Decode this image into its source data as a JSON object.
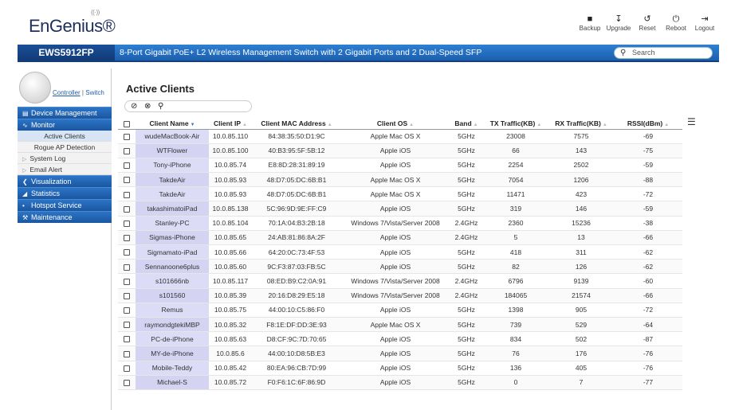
{
  "header": {
    "logo": "EnGenius®",
    "model": "EWS5912FP",
    "description": "8-Port Gigabit PoE+ L2 Wireless Management Switch with 2 Gigabit Ports and 2 Dual-Speed SFP",
    "search_placeholder": "Search",
    "tools": [
      {
        "label": "Backup",
        "icon": "save-icon"
      },
      {
        "label": "Upgrade",
        "icon": "upgrade-icon"
      },
      {
        "label": "Reset",
        "icon": "reset-icon"
      },
      {
        "label": "Reboot",
        "icon": "power-icon"
      },
      {
        "label": "Logout",
        "icon": "logout-icon"
      }
    ]
  },
  "sidebar": {
    "controller": "Controller",
    "separator": "|",
    "switch": "Switch",
    "menu": {
      "device_management": "Device Management",
      "monitor": "Monitor",
      "active_clients": "Active Clients",
      "rogue_ap": "Rogue AP Detection",
      "system_log": "System Log",
      "email_alert": "Email Alert",
      "visualization": "Visualization",
      "statistics": "Statistics",
      "hotspot": "Hotspot Service",
      "maintenance": "Maintenance"
    }
  },
  "main": {
    "title": "Active Clients",
    "columns": [
      "Client Name",
      "Client IP",
      "Client MAC Address",
      "Client OS",
      "Band",
      "TX Traffic(KB)",
      "RX Traffic(KB)",
      "RSSI(dBm)"
    ],
    "rows": [
      [
        "wudeMacBook-Air",
        "10.0.85.110",
        "84:38:35:50:D1:9C",
        "Apple Mac OS X",
        "5GHz",
        "23008",
        "7575",
        "-69"
      ],
      [
        "WTFlower",
        "10.0.85.100",
        "40:B3:95:5F:5B:12",
        "Apple iOS",
        "5GHz",
        "66",
        "143",
        "-75"
      ],
      [
        "Tony-iPhone",
        "10.0.85.74",
        "E8:8D:28:31:89:19",
        "Apple iOS",
        "5GHz",
        "2254",
        "2502",
        "-59"
      ],
      [
        "TakdeAir",
        "10.0.85.93",
        "48:D7:05:DC:6B:B1",
        "Apple Mac OS X",
        "5GHz",
        "7054",
        "1206",
        "-88"
      ],
      [
        "TakdeAir",
        "10.0.85.93",
        "48:D7:05:DC:6B:B1",
        "Apple Mac OS X",
        "5GHz",
        "11471",
        "423",
        "-72"
      ],
      [
        "takashimatoiPad",
        "10.0.85.138",
        "5C:96:9D:9E:FF:C9",
        "Apple iOS",
        "5GHz",
        "319",
        "146",
        "-59"
      ],
      [
        "Stanley-PC",
        "10.0.85.104",
        "70:1A:04:B3:2B:18",
        "Windows 7/Vista/Server 2008",
        "2.4GHz",
        "2360",
        "15236",
        "-38"
      ],
      [
        "Sigmas-iPhone",
        "10.0.85.65",
        "24:AB:81:86:8A:2F",
        "Apple iOS",
        "2.4GHz",
        "5",
        "13",
        "-66"
      ],
      [
        "Sigmamato-iPad",
        "10.0.85.66",
        "64:20:0C:73:4F:53",
        "Apple iOS",
        "5GHz",
        "418",
        "311",
        "-62"
      ],
      [
        "Sennanoone6plus",
        "10.0.85.60",
        "9C:F3:87:03:FB:5C",
        "Apple iOS",
        "5GHz",
        "82",
        "126",
        "-62"
      ],
      [
        "s101666nb",
        "10.0.85.117",
        "08:ED:B9:C2:0A:91",
        "Windows 7/Vista/Server 2008",
        "2.4GHz",
        "6796",
        "9139",
        "-60"
      ],
      [
        "s101560",
        "10.0.85.39",
        "20:16:D8:29:E5:18",
        "Windows 7/Vista/Server 2008",
        "2.4GHz",
        "184065",
        "21574",
        "-66"
      ],
      [
        "Remus",
        "10.0.85.75",
        "44:00:10:C5:86:F0",
        "Apple iOS",
        "5GHz",
        "1398",
        "905",
        "-72"
      ],
      [
        "raymondgtekiMBP",
        "10.0.85.32",
        "F8:1E:DF:DD:3E:93",
        "Apple Mac OS X",
        "5GHz",
        "739",
        "529",
        "-64"
      ],
      [
        "PC-de-iPhone",
        "10.0.85.63",
        "D8:CF:9C:7D:70:65",
        "Apple iOS",
        "5GHz",
        "834",
        "502",
        "-87"
      ],
      [
        "MY-de-iPhone",
        "10.0.85.6",
        "44:00:10:D8:5B:E3",
        "Apple iOS",
        "5GHz",
        "76",
        "176",
        "-76"
      ],
      [
        "Mobile-Teddy",
        "10.0.85.42",
        "80:EA:96:CB:7D:99",
        "Apple iOS",
        "5GHz",
        "136",
        "405",
        "-76"
      ],
      [
        "Michael-S",
        "10.0.85.72",
        "F0:F6:1C:6F:86:9D",
        "Apple iOS",
        "5GHz",
        "0",
        "7",
        "-77"
      ]
    ]
  }
}
